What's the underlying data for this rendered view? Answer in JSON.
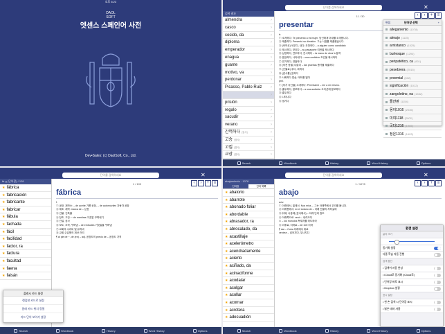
{
  "screen1": {
    "status_time": "오후 6:23",
    "logo_text": "DAOL SOFT",
    "title": "엣센스 스페인어 사전",
    "copyright": "Dev•Sales: (c) DaolSoft, Co., Ltd."
  },
  "screen2": {
    "search_placeholder": "단어를 검색하세요",
    "list_header": "검색 결과",
    "words": [
      {
        "w": "almendra",
        "c": ""
      },
      {
        "w": "casco",
        "c": ""
      },
      {
        "w": "cocido, da",
        "c": ""
      },
      {
        "w": "diploma",
        "c": ""
      },
      {
        "w": "emperador",
        "c": ""
      },
      {
        "w": "enagua",
        "c": ""
      },
      {
        "w": "guante",
        "c": ""
      },
      {
        "w": "motivo, va",
        "c": ""
      },
      {
        "w": "perdonar",
        "c": ""
      },
      {
        "w": "Picasso, Pablo Ruiz",
        "c": ""
      },
      {
        "w": "",
        "c": ""
      },
      {
        "w": "prisión",
        "c": ""
      },
      {
        "w": "regalo",
        "c": ""
      },
      {
        "w": "sacudir",
        "c": ""
      },
      {
        "w": "verano",
        "c": ""
      },
      {
        "w": "간역하다",
        "c": "(동사)"
      },
      {
        "w": "고승",
        "c": "(명사)"
      },
      {
        "w": "고집",
        "c": "(명사)"
      },
      {
        "w": "교상",
        "c": "(명사)"
      }
    ],
    "page_indicator": "11 / 30",
    "headword": "presentar",
    "pos": "tr.",
    "defs": [
      "① 소개하다: Te presento a mi mujer. 당신에게 아내를 소개합니다.",
      "② 제출하다: Presentó su dimisión. 그는 사표를 제출했습니다.",
      "③ (후보로) 세우다, 내다; 추천하다 ‒ a alguien como candidato",
      "④ 제시하다, 보이다 ‒ su pasaporte 여권을 제시하다",
      "⑤ 상영하다, 연주하다, 전시하다 ‒ la mano de obra 노동력",
      "⑥ 표현하다, 나타내다 ‒ una condición 조건을 제시하다",
      "⑦ 연기하다, 연출하다",
      "⑧ (의견 등을) 내놓다 ‒ las pruebas 증거를 제출하다",
      "⑨ (선물로) 주다, 바치다",
      "⑩ (감사를) 표하다",
      "⑪ 사회하다 방송, 태도를 잃다",
      "prnl.",
      "① (자기 자신을) 소개하다: Permítame ‒ me a mí mismo.",
      "② 출두하다, 응모하다 ‒ a una audición 오디션에 응모하다",
      "③ 출두하다",
      "④ 나타나다",
      "⑤ 생기다"
    ],
    "history": {
      "edit": "편집",
      "title": "단어장 선택",
      "add": "+",
      "items": [
        {
          "w": "alleganiento",
          "c": "(1078)"
        },
        {
          "w": "almajo",
          "c": "(1115)"
        },
        {
          "w": "arnistanco",
          "c": "(1525)"
        },
        {
          "w": "burlesque",
          "c": "(1294)"
        },
        {
          "w": "peripatético, ca",
          "c": "(831)"
        },
        {
          "w": "pesebrera",
          "c": "(2015)"
        },
        {
          "w": "proemial",
          "c": "(632)"
        },
        {
          "w": "significación",
          "c": "(1012)"
        },
        {
          "w": "zangolotino, na",
          "c": "(1532)"
        },
        {
          "w": "돌잔판",
          "c": "(1154)"
        },
        {
          "w": "몽이1016",
          "c": "(2036)"
        },
        {
          "w": "미여1118",
          "c": "(2002)"
        },
        {
          "w": "국다1216",
          "c": "(1965)"
        },
        {
          "w": "정은1316",
          "c": "(1603)"
        }
      ]
    },
    "tabs": [
      "Search",
      "Wordbook",
      "History",
      "Word History",
      "Options"
    ]
  },
  "screen3": {
    "search_placeholder": "단어를 검색하세요",
    "list_header": "fá g (단어장) / 128",
    "words": [
      {
        "w": "fábrica"
      },
      {
        "w": "fabricación"
      },
      {
        "w": "fabricante"
      },
      {
        "w": "fabricar"
      },
      {
        "w": "fábula"
      },
      {
        "w": "fachada"
      },
      {
        "w": "fácil"
      },
      {
        "w": "facilidad"
      },
      {
        "w": "factor, ra"
      },
      {
        "w": "factura"
      },
      {
        "w": "facultad"
      },
      {
        "w": "faena"
      },
      {
        "w": "faisán"
      }
    ],
    "page_indicator": "1 / 100",
    "headword": "fábrica",
    "pos": "f.",
    "defs": [
      "① 공장, 제작소: ‒ de aceite 기름 공장, ‒ de automóviles 자동차 공장",
      "② 제조, 제작: marca de ‒ 상표",
      "③ 건물, 건축물",
      "④ 창조, 고안: ~ de mentiras 거짓말 꾸며내기",
      "⑤ 건설, 공사",
      "⑥ 보도, 조작, 꾸며냄 ‒ de embudes 거짓말을 꾸며냄",
      "⑦ 교회의 수리비 및 유지비",
      "⑧ 교회 수입원의 재산 관리",
      "¶ al pie de ~, de (en) ‒ adj. 공장도의 precio de ‒ 공장도 가격"
    ],
    "popup": {
      "title": "플래시 카드 설정",
      "items": [
        "랜덤한 카드로 설정",
        "원래 카드 위치 정렬",
        "카드 단어 보이기 설정"
      ]
    },
    "tabs": [
      "Search",
      "Wordbook",
      "History",
      "Word History",
      "Options"
    ]
  },
  "screen4": {
    "search_placeholder": "단어를 검색하세요",
    "list_header": "abajamiento · 1078",
    "list_tabs": [
      "단어장",
      "단어 목록"
    ],
    "words": [
      {
        "w": "abalorio"
      },
      {
        "w": "abarrote"
      },
      {
        "w": "abonado foliar"
      },
      {
        "w": "abordable"
      },
      {
        "w": "abrasador, ra"
      },
      {
        "w": "abrocalado, da"
      },
      {
        "w": "acastillaje"
      },
      {
        "w": "acelerómetro"
      },
      {
        "w": "acendradamente"
      },
      {
        "w": "acierto"
      },
      {
        "w": "aciñado, da"
      },
      {
        "w": "acinaciforme"
      },
      {
        "w": "acodalar"
      },
      {
        "w": "acolgar"
      },
      {
        "w": "acollar"
      },
      {
        "w": "acornar"
      },
      {
        "w": "acrotera"
      },
      {
        "w": "adecuadión"
      }
    ],
    "page_indicator": "1 / 1078",
    "headword": "abajo",
    "pos": "adv.",
    "defs": [
      "① 아래에서, 밑에서: Nos mira ‒. 그는 아래쪽에서 우리를 봅니다.",
      "② 아래층에서: en el sótano de ‒ 아래 건물의 지하실에",
      "③ 뒤에, 나중에 (문서에서) ‒ 아래 단락 참조",
      "④ 아래쪽으로: venir ‒ 내려오다",
      "⑤ ‒ los monolos 독재자를 타도하라",
      "⑥ 이후로, 이하로 ‒ de 100 이하",
      "¶ dar ‒ Cuba 아래에서 위로",
      "venirse ‒ 넘어지다, 무너지다"
    ],
    "settings": {
      "title": "환경 설정",
      "rows": [
        {
          "l": "글자 크기",
          "t": "sec"
        },
        {
          "l": "",
          "t": "slider"
        },
        {
          "l": "동기화 설정",
          "t": "on"
        },
        {
          "l": "다중 학습 자동 진행",
          "t": "off"
        },
        {
          "l": "검색 옵션",
          "t": "sec"
        },
        {
          "l": "• 검색어 자동 완성",
          "t": "off"
        },
        {
          "l": "• iCloud로 동기화 (iCloud로)",
          "t": "off"
        },
        {
          "l": "• 단어장 바로 표시",
          "t": "off"
        },
        {
          "l": "• Dropbox 설정",
          "t": "off"
        },
        {
          "l": "표시 설정",
          "t": "sec"
        },
        {
          "l": "• 한 손 검색 시 단어장 표시",
          "t": "off"
        },
        {
          "l": "• 밝은 테마 사용",
          "t": "off"
        }
      ]
    },
    "tabs": [
      "Search",
      "Wordbook",
      "History",
      "Word History",
      "Options"
    ]
  }
}
